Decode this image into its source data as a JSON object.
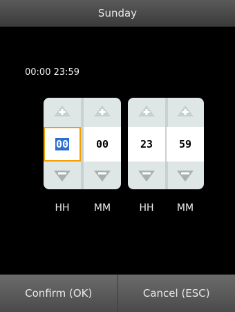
{
  "title": "Sunday",
  "range_text": "00:00  23:59",
  "spinners": [
    {
      "value": "00",
      "label": "HH"
    },
    {
      "value": "00",
      "label": "MM"
    },
    {
      "value": "23",
      "label": "HH"
    },
    {
      "value": "59",
      "label": "MM"
    }
  ],
  "buttons": {
    "confirm": "Confirm (OK)",
    "cancel": "Cancel (ESC)"
  },
  "icons": {
    "increment": "plus-triangle-up-icon",
    "decrement": "minus-triangle-down-icon"
  },
  "colors": {
    "selection_outline": "#f5a000",
    "selection_highlight": "#2d6fcf"
  }
}
